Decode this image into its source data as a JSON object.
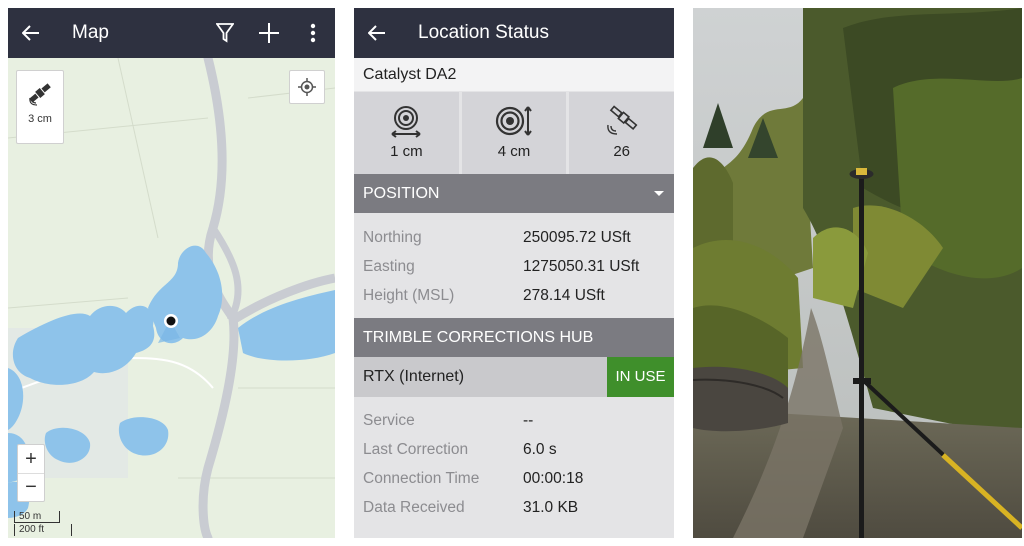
{
  "map_screen": {
    "title": "Map",
    "back_icon": "arrow-left-icon",
    "actions": [
      "filter-icon",
      "plus-icon",
      "more-vertical-icon"
    ],
    "gps_accuracy": "3 cm",
    "zoom_in": "+",
    "zoom_out": "−",
    "scale": {
      "metric": "50 m",
      "imperial": "200 ft"
    },
    "colors": {
      "land": "#e8f0e1",
      "water": "#8ec3ea",
      "road": "#c9ccd2",
      "topbar": "#2e3140"
    }
  },
  "status_screen": {
    "title": "Location Status",
    "device": "Catalyst DA2",
    "tiles": [
      {
        "icon": "horizontal-precision-icon",
        "value": "1 cm"
      },
      {
        "icon": "vertical-precision-icon",
        "value": "4 cm"
      },
      {
        "icon": "satellite-icon",
        "value": "26"
      }
    ],
    "position": {
      "header": "POSITION",
      "rows": [
        {
          "label": "Northing",
          "value": "250095.72 USft"
        },
        {
          "label": "Easting",
          "value": "1275050.31 USft"
        },
        {
          "label": "Height (MSL)",
          "value": "278.14 USft"
        }
      ]
    },
    "hub": {
      "header": "TRIMBLE CORRECTIONS HUB",
      "source": "RTX (Internet)",
      "badge": "IN USE",
      "rows": [
        {
          "label": "Service",
          "value": "--"
        },
        {
          "label": "Last Correction",
          "value": "6.0 s"
        },
        {
          "label": "Connection Time",
          "value": "00:00:18"
        },
        {
          "label": "Data Received",
          "value": "31.0 KB"
        }
      ]
    },
    "colors": {
      "header": "#2e3140",
      "section": "#7b7b81",
      "badge": "#3f8f2b"
    }
  },
  "photo": {
    "subject": "gnss-receiver-on-pole-photo"
  }
}
